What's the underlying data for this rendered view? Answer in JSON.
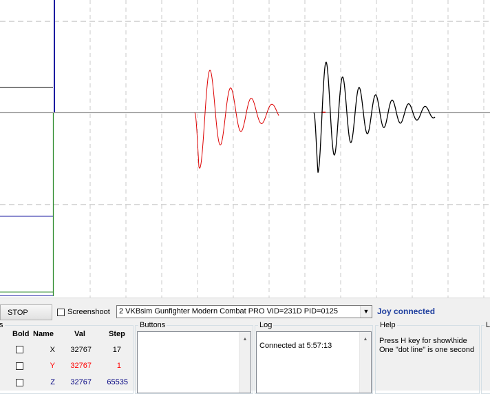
{
  "toolbar": {
    "stop_label": "STOP",
    "screenshot_label": "Screenshoot",
    "device_selected": "2 VKBsim Gunfighter Modern Combat PRO  VID=231D PID=0125",
    "status_text": "Joy connected"
  },
  "axes_table": {
    "headers": {
      "bold": "Bold",
      "name": "Name",
      "val": "Val",
      "step": "Step"
    },
    "rows": [
      {
        "name": "X",
        "val": "32767",
        "step": "17",
        "color": "#000000"
      },
      {
        "name": "Y",
        "val": "32767",
        "step": "1",
        "color": "#ff0000"
      },
      {
        "name": "Z",
        "val": "32767",
        "step": "65535",
        "color": "#000080"
      }
    ]
  },
  "buttons_group": {
    "title": "Buttons"
  },
  "log_group": {
    "title": "Log",
    "entries": [
      "Connected at 5:57:13"
    ]
  },
  "help_group": {
    "title": "Help",
    "line1": "Press H key for show\\hide",
    "line2": "One \"dot line\" is one second"
  },
  "limits_group": {
    "title": "Li"
  },
  "colors": {
    "red_trace": "#dd0000",
    "black_trace": "#000000",
    "blue_trace": "#1a1aa0",
    "green_trace": "#2e8b2e",
    "status_blue": "#1f3f9f",
    "grid": "#c8c8c8"
  }
}
